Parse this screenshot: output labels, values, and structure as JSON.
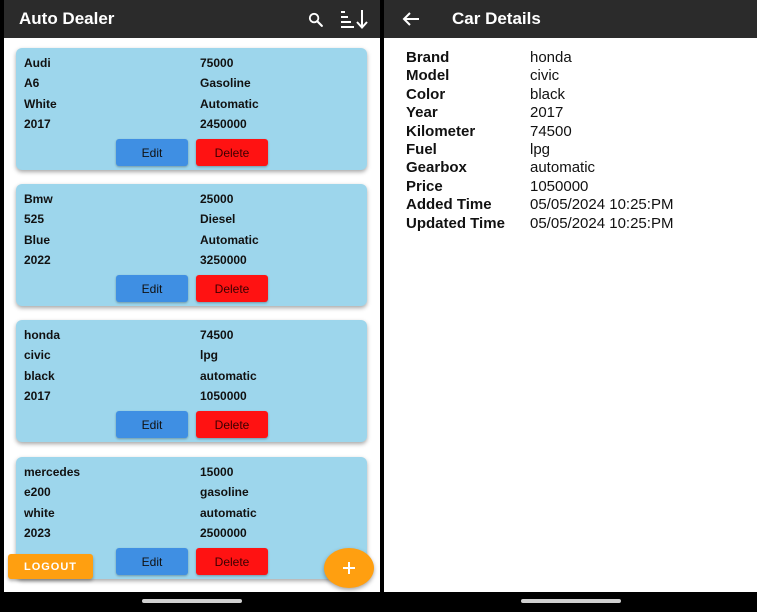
{
  "left": {
    "app_title": "Auto Dealer",
    "cars": [
      {
        "brand": "Audi",
        "model": "A6",
        "color": "White",
        "year": "2017",
        "km": "75000",
        "fuel": "Gasoline",
        "gearbox": "Automatic",
        "price": "2450000"
      },
      {
        "brand": "Bmw",
        "model": "525",
        "color": "Blue",
        "year": "2022",
        "km": "25000",
        "fuel": "Diesel",
        "gearbox": "Automatic",
        "price": "3250000"
      },
      {
        "brand": "honda",
        "model": "civic",
        "color": "black",
        "year": "2017",
        "km": "74500",
        "fuel": "lpg",
        "gearbox": "automatic",
        "price": "1050000"
      },
      {
        "brand": "mercedes",
        "model": "e200",
        "color": "white",
        "year": "2023",
        "km": "15000",
        "fuel": "gasoline",
        "gearbox": "automatic",
        "price": "2500000"
      }
    ],
    "edit_label": "Edit",
    "delete_label": "Delete",
    "logout_label": "LOGOUT",
    "fab_label": "+"
  },
  "right": {
    "title": "Car Details",
    "details": [
      {
        "label": "Brand",
        "value": "honda"
      },
      {
        "label": "Model",
        "value": "civic"
      },
      {
        "label": "Color",
        "value": "black"
      },
      {
        "label": "Year",
        "value": "2017"
      },
      {
        "label": "Kilometer",
        "value": "74500"
      },
      {
        "label": "Fuel",
        "value": "lpg"
      },
      {
        "label": "Gearbox",
        "value": "automatic"
      },
      {
        "label": "Price",
        "value": "1050000"
      },
      {
        "label": "Added Time",
        "value": "05/05/2024 10:25:PM"
      },
      {
        "label": "Updated Time",
        "value": "05/05/2024 10:25:PM"
      }
    ]
  },
  "icons": {
    "search": "search-icon",
    "sort": "sort-descending-icon",
    "back": "arrow-back-icon",
    "add": "plus-icon"
  },
  "colors": {
    "appbar": "#2b2b2b",
    "card": "#9dd6ec",
    "edit": "#3f8fe3",
    "delete": "#ff1212",
    "accent": "#ff9f10"
  }
}
